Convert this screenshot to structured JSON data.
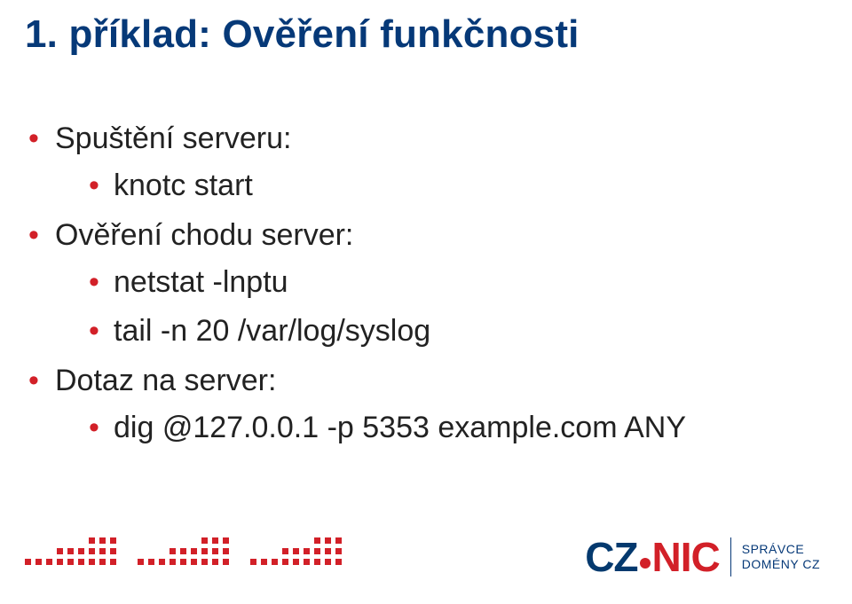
{
  "title": "1. příklad: Ověření funkčnosti",
  "bullets": [
    {
      "text": "Spuštění serveru:",
      "children": [
        {
          "text": "knotc start"
        }
      ]
    },
    {
      "text": "Ověření chodu server:",
      "children": [
        {
          "text": "netstat -lnptu"
        },
        {
          "text": "tail -n 20 /var/log/syslog"
        }
      ]
    },
    {
      "text": "Dotaz na server:",
      "children": [
        {
          "text": "dig @127.0.0.1 -p 5353 example.com ANY"
        }
      ]
    }
  ],
  "logo": {
    "cz": "CZ",
    "nic": "NIC",
    "sub1": "SPRÁVCE",
    "sub2": "DOMÉNY CZ"
  },
  "colors": {
    "brand_blue": "#063978",
    "brand_red": "#d22028"
  }
}
